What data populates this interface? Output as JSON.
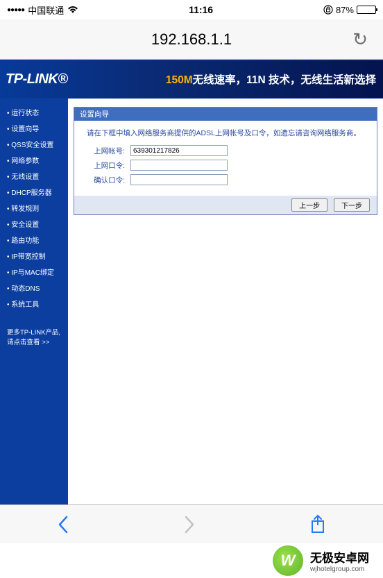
{
  "status": {
    "carrier": "中国联通",
    "time": "11:16",
    "battery_pct": "87%"
  },
  "browser": {
    "url": "192.168.1.1"
  },
  "banner": {
    "logo": "TP-LINK®",
    "slogan_prefix": "150M",
    "slogan_rest": "无线速率，11N 技术，无线生活新选择"
  },
  "sidebar": {
    "items": [
      "运行状态",
      "设置向导",
      "QSS安全设置",
      "网络参数",
      "无线设置",
      "DHCP服务器",
      "转发规则",
      "安全设置",
      "路由功能",
      "IP带宽控制",
      "IP与MAC绑定",
      "动态DNS",
      "系统工具"
    ],
    "promo_line1": "更多TP-LINK产品,",
    "promo_line2": "请点击查看 >>"
  },
  "panel": {
    "title": "设置向导",
    "hint": "请在下框中填入网络服务商提供的ADSL上网帐号及口令，如遗忘请咨询网络服务商。",
    "account_label": "上网帐号:",
    "account_value": "639301217826",
    "password_label": "上网口令:",
    "confirm_label": "确认口令:",
    "btn_prev": "上一步",
    "btn_next": "下一步"
  },
  "watermark": {
    "glyph": "W",
    "title": "无极安卓网",
    "url": "wjhotelgroup.com"
  }
}
